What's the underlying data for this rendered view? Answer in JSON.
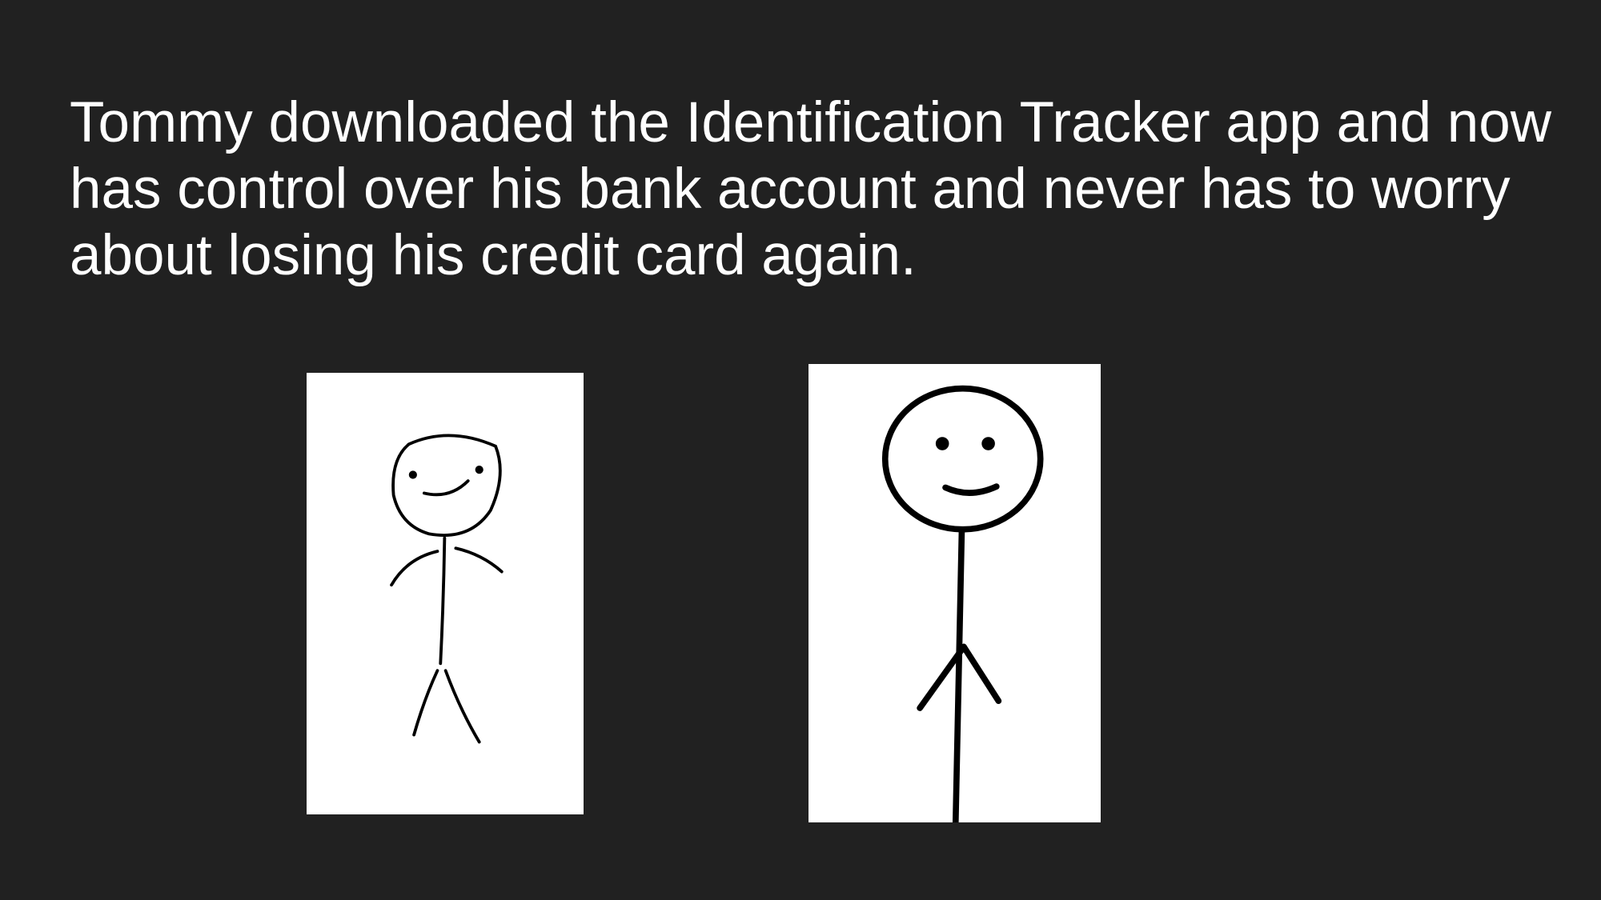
{
  "slide": {
    "caption": "Tommy downloaded the Identification Tracker app and now has control over his bank account and never has to worry about losing his credit card again.",
    "images": [
      {
        "icon": "hand-drawn-stick-figure-icon"
      },
      {
        "icon": "neat-stick-figure-icon"
      }
    ],
    "colors": {
      "background": "#212121",
      "text": "#ffffff",
      "image_background": "#ffffff",
      "stroke": "#000000"
    }
  }
}
